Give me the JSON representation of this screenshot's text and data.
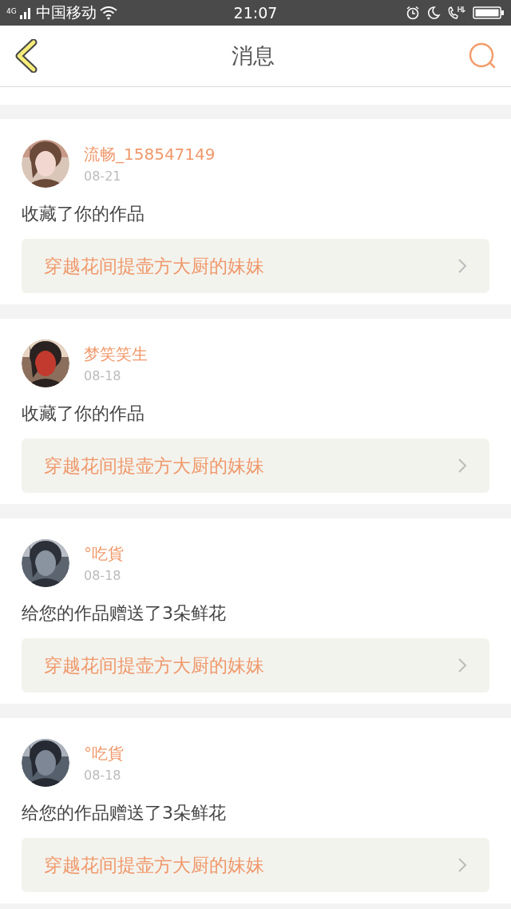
{
  "status_bar": {
    "network": "4G",
    "carrier": "中国移动",
    "time": "21:07"
  },
  "header": {
    "title": "消息"
  },
  "messages": [
    {
      "user": "流畅_158547149",
      "date": "08-21",
      "action": "收藏了你的作品",
      "work": "穿越花间提壶方大厨的妹妹"
    },
    {
      "user": "梦笑笑生",
      "date": "08-18",
      "action": "收藏了你的作品",
      "work": "穿越花间提壶方大厨的妹妹"
    },
    {
      "user": "°吃貨",
      "date": "08-18",
      "action": "给您的作品赠送了3朵鲜花",
      "work": "穿越花间提壶方大厨的妹妹"
    },
    {
      "user": "°吃貨",
      "date": "08-18",
      "action": "给您的作品赠送了3朵鲜花",
      "work": "穿越花间提壶方大厨的妹妹"
    }
  ]
}
